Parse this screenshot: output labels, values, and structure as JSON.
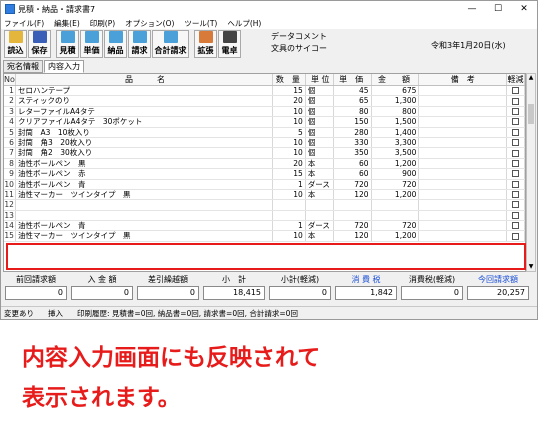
{
  "window": {
    "title": "見積・納品・請求書7",
    "minimize": "—",
    "maximize": "☐",
    "close": "✕"
  },
  "menu": [
    "ファイル(F)",
    "編集(E)",
    "印刷(P)",
    "オプション(O)",
    "ツール(T)",
    "ヘルプ(H)"
  ],
  "toolbar": [
    {
      "label": "読込",
      "icon": "folder-icon",
      "color": "#e4b63c"
    },
    {
      "label": "保存",
      "icon": "disk-icon",
      "color": "#3a5fb8"
    },
    {
      "label": "見積",
      "icon": "doc-icon",
      "color": "#4aa0d8"
    },
    {
      "label": "単価",
      "icon": "doc-icon",
      "color": "#4aa0d8"
    },
    {
      "label": "納品",
      "icon": "doc-icon",
      "color": "#4aa0d8"
    },
    {
      "label": "請求",
      "icon": "doc-icon",
      "color": "#4aa0d8"
    },
    {
      "label": "合計請求",
      "icon": "doc-icon",
      "color": "#4aa0d8"
    },
    {
      "label": "拡張",
      "icon": "expand-icon",
      "color": "#d87b3a"
    },
    {
      "label": "電卓",
      "icon": "calculator-icon",
      "color": "#444444"
    }
  ],
  "data_comment": {
    "label": "データコメント",
    "value": "文具のサイコー"
  },
  "date": "令和3年1月20日(水)",
  "tabs": [
    "宛名情報",
    "内容入力"
  ],
  "columns": {
    "no": "No",
    "item": "品　　　名",
    "qty": "数　量",
    "unit": "単 位",
    "price": "単　価",
    "amount": "金　　額",
    "note": "備　考",
    "tax": "軽減"
  },
  "rows": [
    {
      "no": "1",
      "item": "セロハンテープ",
      "qty": "15",
      "unit": "個",
      "price": "45",
      "amount": "675"
    },
    {
      "no": "2",
      "item": "スティックのり",
      "qty": "20",
      "unit": "個",
      "price": "65",
      "amount": "1,300"
    },
    {
      "no": "3",
      "item": "レターファイルA4タテ",
      "qty": "10",
      "unit": "個",
      "price": "80",
      "amount": "800"
    },
    {
      "no": "4",
      "item": "クリアファイルA4タテ　30ポケット",
      "qty": "10",
      "unit": "個",
      "price": "150",
      "amount": "1,500"
    },
    {
      "no": "5",
      "item": "封筒　A3　10枚入り",
      "qty": "5",
      "unit": "個",
      "price": "280",
      "amount": "1,400"
    },
    {
      "no": "6",
      "item": "封筒　角3　20枚入り",
      "qty": "10",
      "unit": "個",
      "price": "330",
      "amount": "3,300"
    },
    {
      "no": "7",
      "item": "封筒　角2　30枚入り",
      "qty": "10",
      "unit": "個",
      "price": "350",
      "amount": "3,500"
    },
    {
      "no": "8",
      "item": "油性ボールペン　黒",
      "qty": "20",
      "unit": "本",
      "price": "60",
      "amount": "1,200"
    },
    {
      "no": "9",
      "item": "油性ボールペン　赤",
      "qty": "15",
      "unit": "本",
      "price": "60",
      "amount": "900"
    },
    {
      "no": "10",
      "item": "油性ボールペン　青",
      "qty": "1",
      "unit": "ダース",
      "price": "720",
      "amount": "720"
    },
    {
      "no": "11",
      "item": "油性マーカー　ツインタイプ　黒",
      "qty": "10",
      "unit": "本",
      "price": "120",
      "amount": "1,200"
    },
    {
      "no": "12",
      "item": "",
      "qty": "",
      "unit": "",
      "price": "",
      "amount": ""
    },
    {
      "no": "13",
      "item": "",
      "qty": "",
      "unit": "",
      "price": "",
      "amount": ""
    },
    {
      "no": "14",
      "item": "油性ボールペン　青",
      "qty": "1",
      "unit": "ダース",
      "price": "720",
      "amount": "720"
    },
    {
      "no": "15",
      "item": "油性マーカー　ツインタイプ　黒",
      "qty": "10",
      "unit": "本",
      "price": "120",
      "amount": "1,200"
    }
  ],
  "totals": [
    {
      "label": "前回請求額",
      "value": "0",
      "blue": false
    },
    {
      "label": "入 金 額",
      "value": "0",
      "blue": false
    },
    {
      "label": "差引繰越額",
      "value": "0",
      "blue": false
    },
    {
      "label": "小　計",
      "value": "18,415",
      "blue": false
    },
    {
      "label": "小計(軽減)",
      "value": "0",
      "blue": false
    },
    {
      "label": "消 費 税",
      "value": "1,842",
      "blue": true
    },
    {
      "label": "消費税(軽減)",
      "value": "0",
      "blue": false
    },
    {
      "label": "今回請求額",
      "value": "20,257",
      "blue": true
    }
  ],
  "status": [
    "変更あり",
    "挿入",
    "印刷履歴: 見積書=0回, 納品書=0回, 請求書=0回, 合計請求=0回"
  ],
  "caption": [
    "内容入力画面にも反映されて",
    "表示されます。"
  ]
}
